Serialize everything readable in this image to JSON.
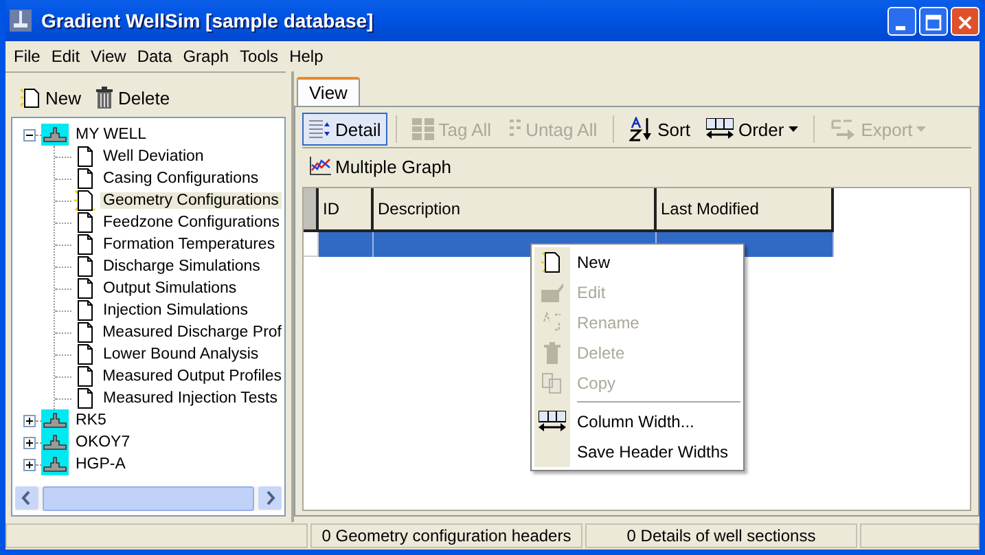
{
  "window": {
    "title": "Gradient WellSim [sample database]"
  },
  "menu": [
    "File",
    "Edit",
    "View",
    "Data",
    "Graph",
    "Tools",
    "Help"
  ],
  "left_toolbar": [
    {
      "label": "New",
      "kind": "new"
    },
    {
      "label": "Delete",
      "kind": "delete"
    }
  ],
  "tree": [
    {
      "label": "MY WELL",
      "expanded": true,
      "selected": false,
      "children": [
        {
          "label": "Well Deviation",
          "selected": false,
          "kind": "doc"
        },
        {
          "label": "Casing Configurations",
          "selected": false,
          "kind": "doc"
        },
        {
          "label": "Geometry Configurations",
          "selected": true,
          "kind": "doc-new"
        },
        {
          "label": "Feedzone Configurations",
          "selected": false,
          "kind": "doc"
        },
        {
          "label": "Formation Temperatures",
          "selected": false,
          "kind": "doc"
        },
        {
          "label": "Discharge Simulations",
          "selected": false,
          "kind": "doc"
        },
        {
          "label": "Output Simulations",
          "selected": false,
          "kind": "doc"
        },
        {
          "label": "Injection Simulations",
          "selected": false,
          "kind": "doc"
        },
        {
          "label": "Measured Discharge Prof",
          "selected": false,
          "kind": "doc"
        },
        {
          "label": "Lower Bound Analysis",
          "selected": false,
          "kind": "doc"
        },
        {
          "label": "Measured Output Profiles",
          "selected": false,
          "kind": "doc"
        },
        {
          "label": "Measured Injection Tests",
          "selected": false,
          "kind": "doc"
        }
      ]
    },
    {
      "label": "RK5",
      "expanded": false,
      "selected": false
    },
    {
      "label": "OKOY7",
      "expanded": false,
      "selected": false
    },
    {
      "label": "HGP-A",
      "expanded": false,
      "selected": false
    }
  ],
  "tabs": [
    {
      "label": "View",
      "selected": true
    }
  ],
  "toolbar": [
    {
      "kind": "detail",
      "label": "Detail",
      "pressed": true,
      "disabled": false,
      "dropdown": false
    },
    {
      "kind": "separator"
    },
    {
      "kind": "tag",
      "label": "Tag All",
      "pressed": false,
      "disabled": true,
      "dropdown": false
    },
    {
      "kind": "untag",
      "label": "Untag All",
      "pressed": false,
      "disabled": true,
      "dropdown": false
    },
    {
      "kind": "separator"
    },
    {
      "kind": "sort",
      "label": "Sort",
      "pressed": false,
      "disabled": false,
      "dropdown": false
    },
    {
      "kind": "order",
      "label": "Order",
      "pressed": false,
      "disabled": false,
      "dropdown": true
    },
    {
      "kind": "separator"
    },
    {
      "kind": "export",
      "label": "Export",
      "pressed": false,
      "disabled": true,
      "dropdown": true
    }
  ],
  "toolbar2": [
    {
      "kind": "graph",
      "label": "Multiple Graph"
    }
  ],
  "grid": {
    "columns": [
      "ID",
      "Description",
      "Last Modified"
    ],
    "rows": [
      {
        "selected": true
      }
    ]
  },
  "context_menu": [
    {
      "kind": "new",
      "label": "New",
      "disabled": false
    },
    {
      "kind": "edit",
      "label": "Edit",
      "disabled": true
    },
    {
      "kind": "rename",
      "label": "Rename",
      "disabled": true
    },
    {
      "kind": "delete",
      "label": "Delete",
      "disabled": true
    },
    {
      "kind": "copy",
      "label": "Copy",
      "disabled": true
    },
    {
      "kind": "separator"
    },
    {
      "kind": "order",
      "label": "Column Width...",
      "disabled": false
    },
    {
      "kind": "plain",
      "label": "Save Header Widths",
      "disabled": false
    }
  ],
  "status_bar": [
    "0 Geometry configuration headers",
    "0 Details of well sectionss"
  ]
}
